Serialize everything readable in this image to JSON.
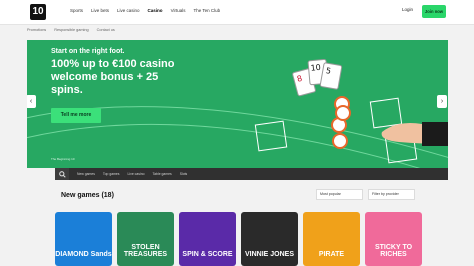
{
  "header": {
    "logo": "10",
    "nav": [
      "Sports",
      "Live bets",
      "Live casino",
      "Casino",
      "Virtuals",
      "The Ten Club"
    ],
    "active_nav": "Casino",
    "login_label": "Login",
    "join_label": "Join now"
  },
  "subnav": [
    "Promotions",
    "Responsible gaming",
    "Contact us"
  ],
  "hero": {
    "kicker": "Start on the right foot.",
    "headline": "100% up to €100 casino welcome bonus + 25 spins.",
    "cta_label": "Tell me more",
    "caption": "The Beginning 10",
    "cards": [
      "8",
      "10",
      "5"
    ]
  },
  "category_tabs": [
    "New games",
    "Top games",
    "Live casino",
    "Table games",
    "Slots"
  ],
  "section": {
    "title": "New games (18)",
    "sort_label": "Most popular",
    "filter_label": "Filter by provider"
  },
  "games": [
    {
      "title": "DIAMOND Sands",
      "bg": "#1b7fd8"
    },
    {
      "title": "STOLEN TREASURES",
      "bg": "#2a8a57"
    },
    {
      "title": "SPIN & SCORE",
      "bg": "#5a2aa8"
    },
    {
      "title": "VINNIE JONES",
      "bg": "#2a2a2a"
    },
    {
      "title": "PIRATE",
      "bg": "#f0a11a"
    },
    {
      "title": "STICKY TO RICHES",
      "bg": "#f06a9a"
    }
  ],
  "colors": {
    "accent": "#2ad66a",
    "hero_bg": "#27a862",
    "tabs_bg": "#303030"
  }
}
